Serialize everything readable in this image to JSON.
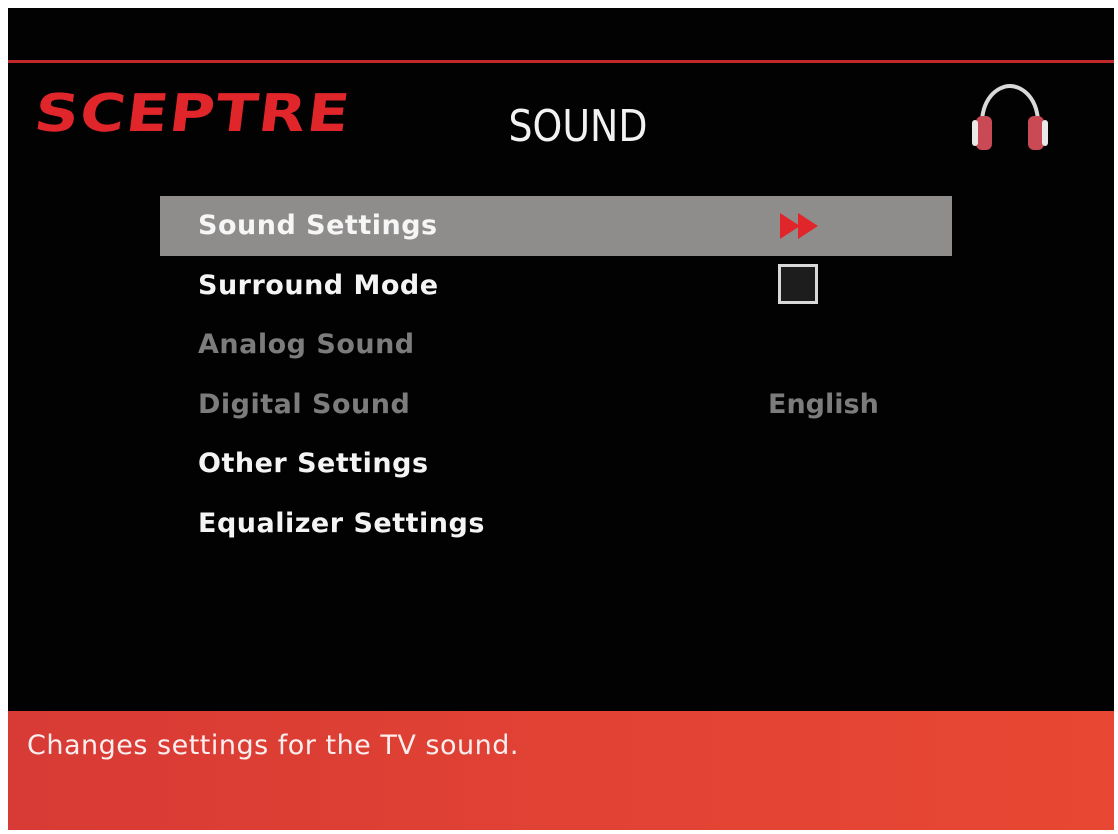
{
  "header": {
    "logo_text": "SCEPTRE",
    "title": "SOUND",
    "icon": "headphones-icon"
  },
  "menu": {
    "items": [
      {
        "label": "Sound Settings",
        "state": "selected",
        "indicator": "double-arrow-right-icon"
      },
      {
        "label": "Surround Mode",
        "state": "enabled",
        "indicator": "checkbox",
        "checked": false
      },
      {
        "label": "Analog Sound",
        "state": "disabled"
      },
      {
        "label": "Digital Sound",
        "state": "disabled",
        "value": "English"
      },
      {
        "label": "Other Settings",
        "state": "enabled"
      },
      {
        "label": "Equalizer Settings",
        "state": "enabled"
      }
    ]
  },
  "status": {
    "text": "Changes settings for the TV sound."
  },
  "colors": {
    "brand_red": "#e0262a",
    "selected_row": "#8e8d8b",
    "status_bar": "#e14234",
    "disabled_text": "#7c7c7c"
  }
}
